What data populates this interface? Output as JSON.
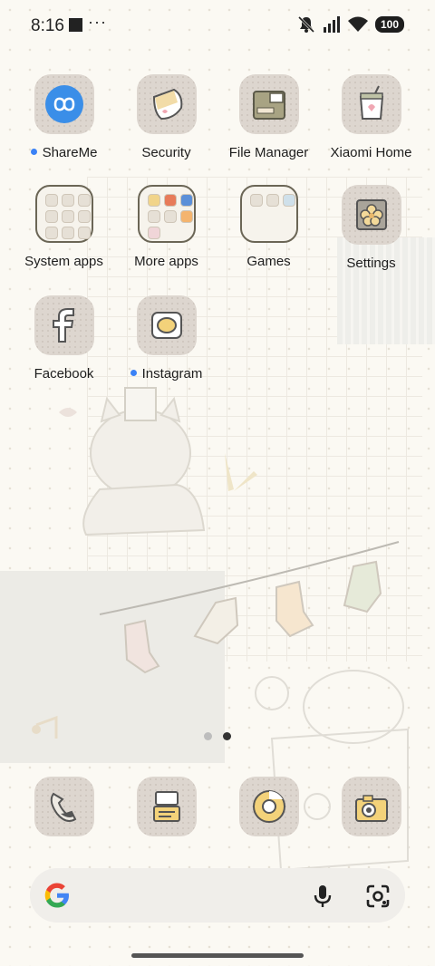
{
  "status_bar": {
    "time": "8:16",
    "overflow": "···",
    "battery": "100"
  },
  "apps": [
    {
      "name": "ShareMe",
      "icon": "shareme-icon",
      "new": true
    },
    {
      "name": "Security",
      "icon": "security-icon",
      "new": false
    },
    {
      "name": "File Manager",
      "icon": "file-manager-icon",
      "new": false
    },
    {
      "name": "Xiaomi Home",
      "icon": "xiaomi-home-icon",
      "new": false
    },
    {
      "name": "System apps",
      "icon": "folder-icon",
      "new": false
    },
    {
      "name": "More apps",
      "icon": "folder-icon",
      "new": false
    },
    {
      "name": "Games",
      "icon": "folder-icon",
      "new": false
    },
    {
      "name": "Settings",
      "icon": "settings-icon",
      "new": false
    },
    {
      "name": "Facebook",
      "icon": "facebook-icon",
      "new": false
    },
    {
      "name": "Instagram",
      "icon": "instagram-icon",
      "new": true
    }
  ],
  "dock": [
    {
      "icon": "phone-icon"
    },
    {
      "icon": "messages-icon"
    },
    {
      "icon": "chrome-icon"
    },
    {
      "icon": "camera-icon"
    }
  ],
  "pager": {
    "pages": 2,
    "current": 2
  },
  "colors": {
    "accent_blue": "#3b82f6",
    "icon_tile": "#ddd6cf",
    "wallpaper": "#fbf9f3"
  }
}
